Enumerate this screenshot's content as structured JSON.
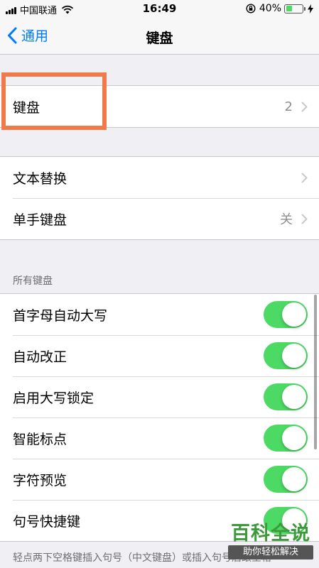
{
  "status_bar": {
    "carrier": "中国联通",
    "time": "16:49",
    "battery_percent": "40%",
    "battery_level": 0.4,
    "battery_color": "#4cd964"
  },
  "nav": {
    "back_label": "通用",
    "title": "键盘",
    "accent_color": "#007aff"
  },
  "keyboards_row": {
    "label": "键盘",
    "value": "2"
  },
  "group2": [
    {
      "label": "文本替换",
      "value": ""
    },
    {
      "label": "单手键盘",
      "value": "关"
    }
  ],
  "all_keyboards": {
    "header": "所有键盘",
    "toggles": [
      {
        "label": "首字母自动大写",
        "on": true
      },
      {
        "label": "自动改正",
        "on": true
      },
      {
        "label": "启用大写锁定",
        "on": true
      },
      {
        "label": "智能标点",
        "on": true
      },
      {
        "label": "字符预览",
        "on": true
      },
      {
        "label": "句号快捷键",
        "on": true
      }
    ],
    "toggle_on_color": "#4cd964"
  },
  "footer": {
    "text": "轻点两下空格键插入句号（中文键盘）或插入句号后跟空格"
  },
  "watermark": {
    "title": "百科全说",
    "subtitle": "助你轻松解决"
  },
  "highlight": {
    "color": "#f07a4a",
    "target": "keyboards_row"
  }
}
